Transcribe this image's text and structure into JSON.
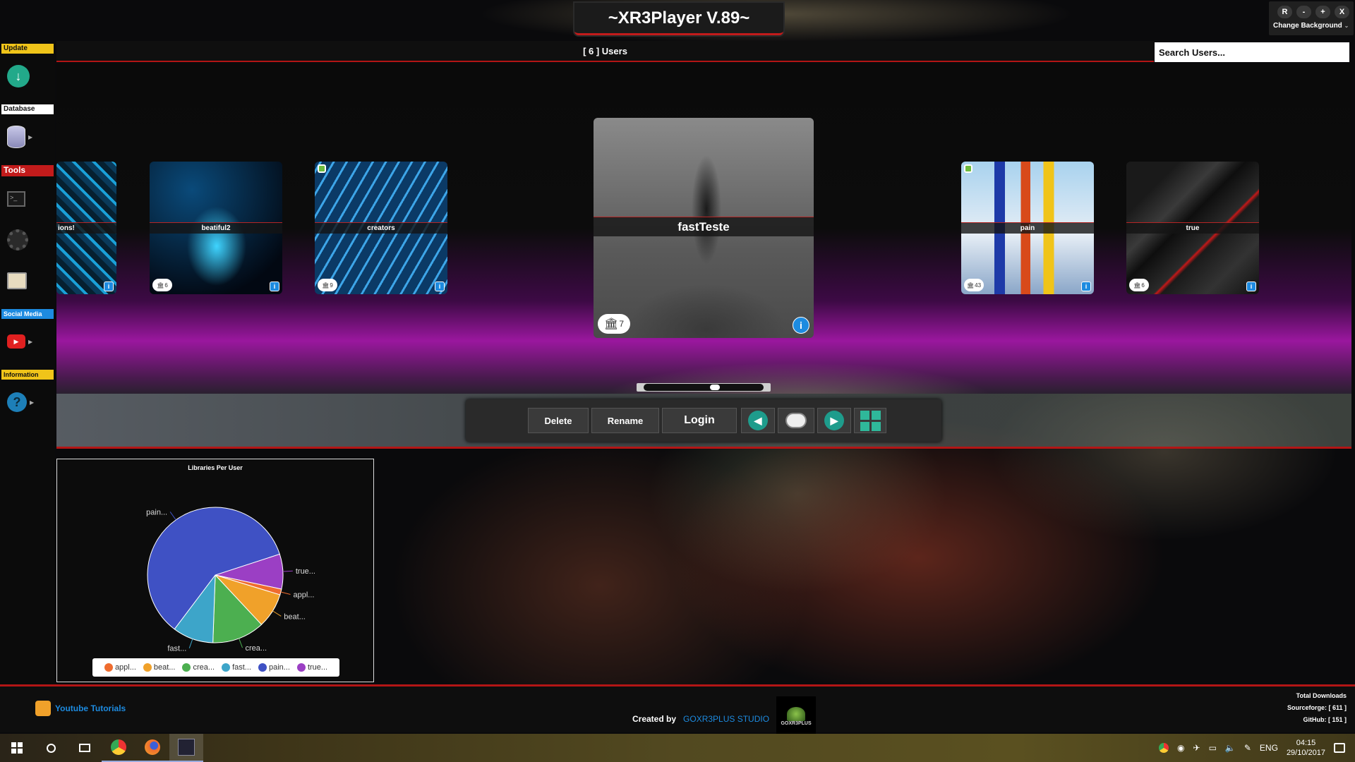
{
  "app": {
    "title": "~XR3Player V.89~"
  },
  "window_controls": {
    "r": "R",
    "minimize": "-",
    "maximize": "+",
    "close": "X",
    "change_background": "Change Background"
  },
  "sidebar": {
    "update": "Update",
    "database": "Database",
    "tools": "Tools",
    "social_media": "Social Media",
    "information": "Information"
  },
  "header": {
    "users_count": "[ 6 ] Users",
    "search_placeholder": "Search Users..."
  },
  "users": [
    {
      "name": "ions!",
      "libraries": ""
    },
    {
      "name": "beatiful2",
      "libraries": "6"
    },
    {
      "name": "creators",
      "libraries": "9"
    },
    {
      "name": "fastTeste",
      "libraries": "7"
    },
    {
      "name": "pain",
      "libraries": "43"
    },
    {
      "name": "true",
      "libraries": "6"
    }
  ],
  "toolbar": {
    "delete": "Delete",
    "rename": "Rename",
    "login": "Login"
  },
  "chart_data": {
    "type": "pie",
    "title": "Libraries Per User",
    "slices": [
      {
        "label": "appl...",
        "value": 1,
        "color": "#ef6c2e"
      },
      {
        "label": "beat...",
        "value": 6,
        "color": "#f0a12a"
      },
      {
        "label": "crea...",
        "value": 9,
        "color": "#4caf50"
      },
      {
        "label": "fast...",
        "value": 7,
        "color": "#3da5c9"
      },
      {
        "label": "pain...",
        "value": 43,
        "color": "#3f51c4"
      },
      {
        "label": "true...",
        "value": 6,
        "color": "#9b3fc4"
      }
    ]
  },
  "footer": {
    "youtube": "Youtube Tutorials",
    "created_by": "Created by",
    "studio": "GOXR3PLUS STUDIO",
    "logo_text": "GOXR3PLUS",
    "total_downloads": "Total Downloads",
    "sourceforge": "Sourceforge: [ 611 ]",
    "github": "GitHub: [ 151 ]"
  },
  "taskbar": {
    "lang": "ENG",
    "time": "04:15",
    "date": "29/10/2017"
  },
  "colors": {
    "accent_red": "#b31515",
    "teal": "#1e9c8c",
    "purple": "#9a179e"
  }
}
